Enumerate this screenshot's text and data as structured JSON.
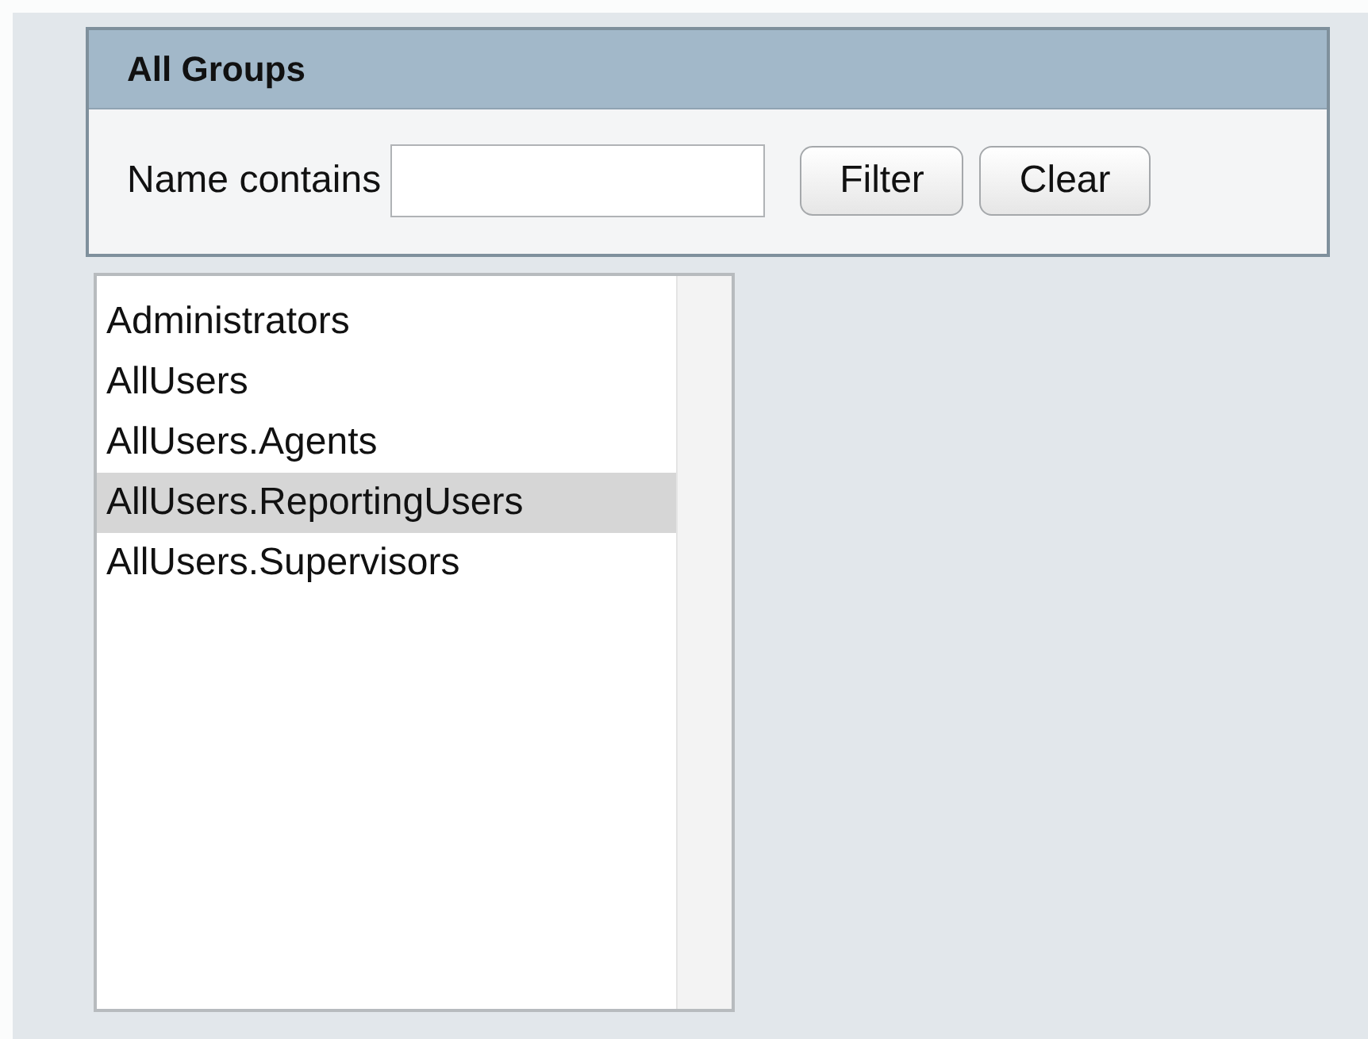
{
  "panel": {
    "title": "All Groups",
    "filter_label": "Name contains",
    "buttons": [
      "Filter",
      "Clear"
    ]
  },
  "groups": [
    {
      "name": "Administrators",
      "selected": false
    },
    {
      "name": "AllUsers",
      "selected": false
    },
    {
      "name": "AllUsers.Agents",
      "selected": false
    },
    {
      "name": "AllUsers.ReportingUsers",
      "selected": true
    },
    {
      "name": "AllUsers.Supervisors",
      "selected": false
    }
  ]
}
